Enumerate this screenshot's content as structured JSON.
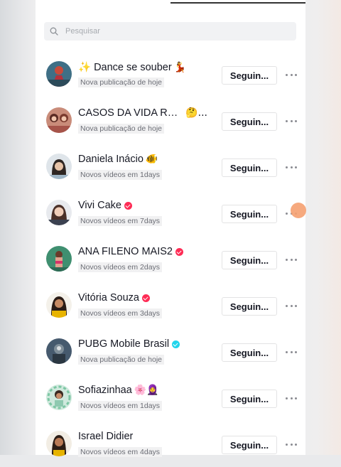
{
  "search": {
    "placeholder": "Pesquisar"
  },
  "colors": {
    "verified_orange": "#fe2c55",
    "verified_blue": "#20d5ec",
    "accent_touch": "#f5a070"
  },
  "accounts": [
    {
      "name": "✨ Dance se souber",
      "emoji": "💃",
      "subtitle": "Nova publicação de hoje",
      "follow_label": "Seguin...",
      "verified": ""
    },
    {
      "name": "CASOS DA VIDA REAL",
      "emoji": "🤔...",
      "subtitle": "Nova publicação de hoje",
      "follow_label": "Seguin...",
      "verified": ""
    },
    {
      "name": "Daniela Inácio",
      "emoji": "🐠",
      "subtitle": "Novos vídeos em 1days",
      "follow_label": "Seguin...",
      "verified": ""
    },
    {
      "name": "Vivi Cake",
      "emoji": "",
      "subtitle": "Novos vídeos em 7days",
      "follow_label": "Seguin...",
      "verified": "orange"
    },
    {
      "name": "ANA FILENO MAIS2",
      "emoji": "",
      "subtitle": "Novos vídeos em 2days",
      "follow_label": "Seguin...",
      "verified": "orange"
    },
    {
      "name": "Vitória Souza",
      "emoji": "",
      "subtitle": "Novos vídeos em 3days",
      "follow_label": "Seguin...",
      "verified": "orange"
    },
    {
      "name": "PUBG Mobile Brasil",
      "emoji": "",
      "subtitle": "Nova publicação de hoje",
      "follow_label": "Seguin...",
      "verified": "blue"
    },
    {
      "name": "Sofiazinhaa",
      "emoji": "🌸🧕",
      "subtitle": "Novos vídeos em 1days",
      "follow_label": "Seguin...",
      "verified": ""
    },
    {
      "name": "Israel Didier",
      "emoji": "",
      "subtitle": "Novos vídeos em 4days",
      "follow_label": "Seguin...",
      "verified": ""
    }
  ]
}
